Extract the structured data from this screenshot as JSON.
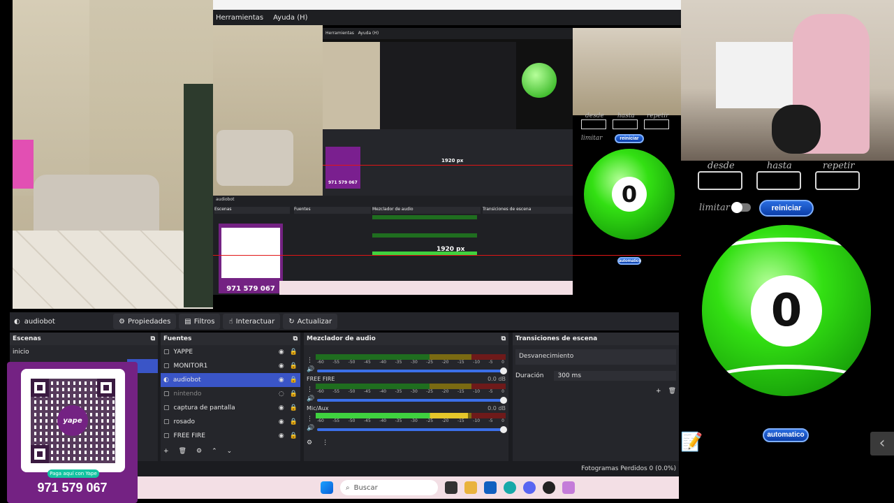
{
  "menubar": {
    "tools": "Herramientas",
    "help": "Ayuda (H)"
  },
  "nested": {
    "tools": "Herramientas",
    "help": "Ayuda (H)",
    "dims": "1920 px",
    "qr_phone": "971 579 067",
    "scene_header": "Escenas",
    "sources_header": "Fuentes",
    "mixer_header": "Mezclador de audio",
    "transitions_header": "Transiciones de escena"
  },
  "right_panel": {
    "desde": "desde",
    "hasta": "hasta",
    "repetir": "repetir",
    "limitar": "limitar",
    "reiniciar": "reiniciar",
    "automatico": "automatico",
    "ball_number": "0"
  },
  "dockbar": {
    "source_name": "audiobot",
    "properties": "Propiedades",
    "filters": "Filtros",
    "interact": "Interactuar",
    "refresh": "Actualizar"
  },
  "scenes": {
    "header": "Escenas",
    "items": [
      "inicio"
    ]
  },
  "sources": {
    "header": "Fuentes",
    "items": [
      {
        "label": "YAPPE",
        "dim": false
      },
      {
        "label": "MONITOR1",
        "dim": false
      },
      {
        "label": "audiobot",
        "dim": false,
        "selected": true
      },
      {
        "label": "nintendo",
        "dim": true
      },
      {
        "label": "captura de pantalla",
        "dim": false
      },
      {
        "label": "rosado",
        "dim": false
      },
      {
        "label": "FREE FIRE",
        "dim": false
      }
    ]
  },
  "mixer": {
    "header": "Mezclador de audio",
    "ticks": [
      "-60",
      "-55",
      "-50",
      "-45",
      "-40",
      "-35",
      "-30",
      "-25",
      "-20",
      "-15",
      "-10",
      "-5",
      "0"
    ],
    "channels": [
      {
        "name": "",
        "db": "",
        "active": false
      },
      {
        "name": "FREE FIRE",
        "db": "0.0 dB",
        "active": false
      },
      {
        "name": "Mic/Aux",
        "db": "0.0 dB",
        "active": true
      }
    ]
  },
  "transitions": {
    "header": "Transiciones de escena",
    "type": "Desvanecimiento",
    "duration_label": "Duración",
    "duration_value": "300 ms"
  },
  "status": {
    "dropped_frames": "Fotogramas Perdidos 0 (0.0%)"
  },
  "taskbar": {
    "search_placeholder": "Buscar"
  },
  "qr": {
    "badge": "Paga aquí con Yape",
    "phone": "971 579 067",
    "logo": "yape"
  }
}
